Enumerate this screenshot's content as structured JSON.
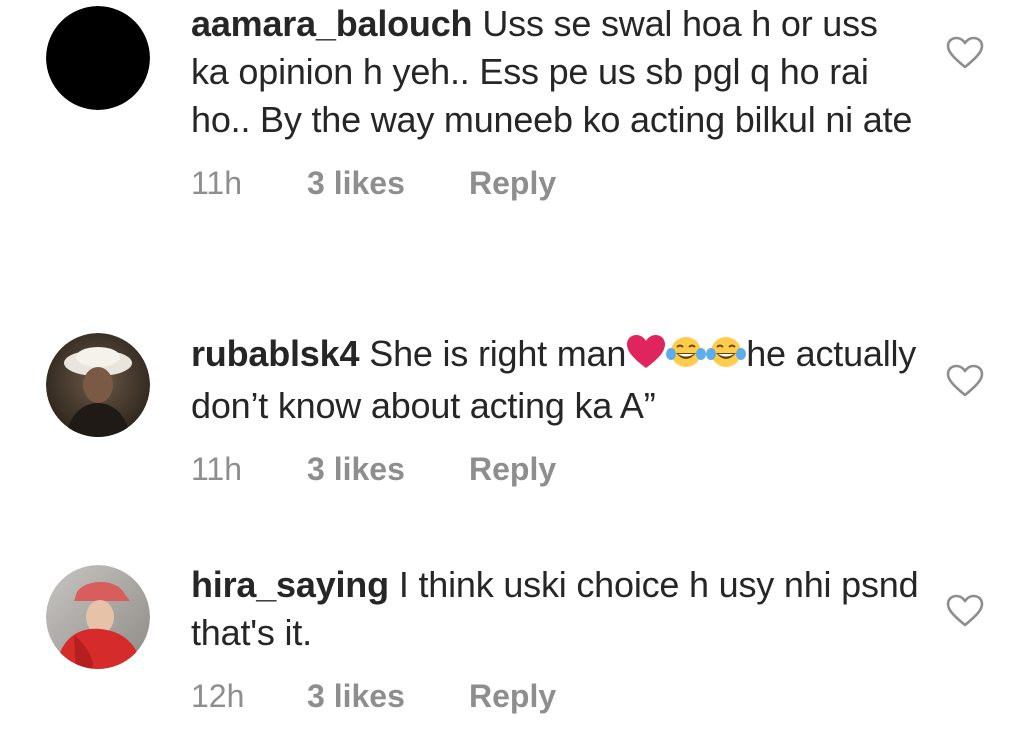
{
  "comments": [
    {
      "username": "aamara_balouch",
      "text": "Uss se swal hoa h or uss ka opinion h yeh.. Ess pe us sb pgl q ho rai ho.. By the way muneeb ko acting bilkul ni ate",
      "time": "11h",
      "likes": "3 likes",
      "reply": "Reply",
      "avatar": "black-circle-avatar"
    },
    {
      "username": "rubablsk4",
      "text_before": "She is right man",
      "emojis": [
        "red-heart",
        "tears-of-joy",
        "tears-of-joy"
      ],
      "text_after": "he actually don’t know about acting ka A”",
      "time": "11h",
      "likes": "3 likes",
      "reply": "Reply",
      "avatar": "child-in-hat-photo-avatar"
    },
    {
      "username": "hira_saying",
      "text": "I think uski choice h usy nhi psnd that's it.",
      "time": "12h",
      "likes": "3 likes",
      "reply": "Reply",
      "avatar": "person-in-red-cap-photo-avatar"
    }
  ],
  "colors": {
    "text": "#262626",
    "meta": "#8e8e8e",
    "heart_emoji": "#e0245e",
    "like_icon_stroke": "#8e8e8e"
  }
}
